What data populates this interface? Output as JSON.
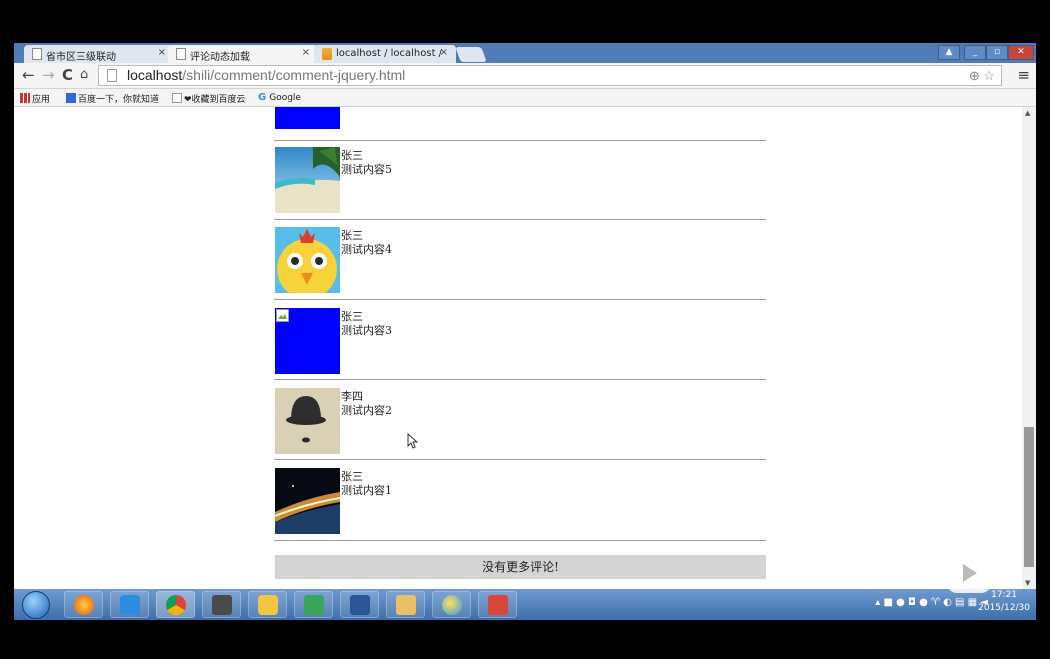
{
  "browser": {
    "tabs": [
      {
        "label": "省市区三级联动",
        "active": false,
        "icon": "page-icon"
      },
      {
        "label": "评论动态加载",
        "active": true,
        "icon": "page-icon"
      },
      {
        "label": "localhost / localhost / ",
        "active": false,
        "icon": "phpmyadmin-icon"
      }
    ],
    "close_glyph": "×",
    "url_host": "localhost",
    "url_path": "/shili/comment/comment-jquery.html",
    "bookmarks": {
      "apps": "应用",
      "baidu": "百度一下，你就知道",
      "fav": "❤收藏到百度云",
      "google": "Google"
    }
  },
  "comments": [
    {
      "author": "张三",
      "text": "测试内容5",
      "image": "beach"
    },
    {
      "author": "张三",
      "text": "测试内容4",
      "image": "chick"
    },
    {
      "author": "张三",
      "text": "测试内容3",
      "image": "broken-blue"
    },
    {
      "author": "李四",
      "text": "测试内容2",
      "image": "bowler-hat"
    },
    {
      "author": "张三",
      "text": "测试内容1",
      "image": "space"
    }
  ],
  "no_more_label": "没有更多评论!",
  "taskbar": {
    "clock_time": "17:21",
    "clock_date": "2015/12/30"
  },
  "colors": {
    "blue_placeholder": "#0000ff",
    "taskbar": "#4a7ab8",
    "no_more_bg": "#d4d4d4"
  }
}
